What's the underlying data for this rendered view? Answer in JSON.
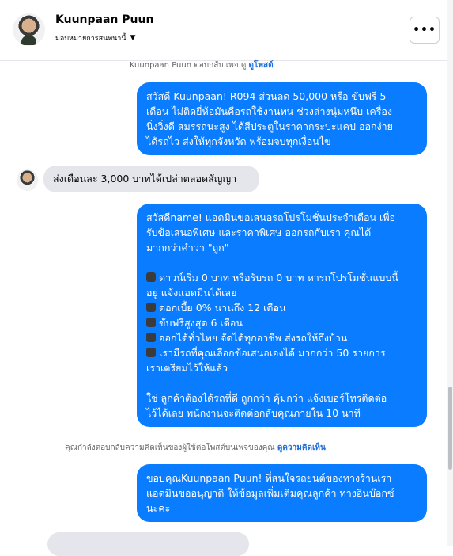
{
  "header": {
    "contact_name": "Kuunpaan Puun",
    "assign_label": "มอบหมายการสนทนานี้",
    "more_label": "•••"
  },
  "messages": {
    "top_note": {
      "text": "Kuunpaan Puun ตอบกลับ เพจ ดู",
      "link": "ดูโพสต์"
    },
    "out1": {
      "lines": [
        "สวัสดี Kuunpaan! R094 ส่วนลด 50,000 หรือ ขับฟรี 5",
        "เดือน ไม่ติดยี่ห้อมันคือรถใช้งานทน ช่วงล่างนุ่มหนึบ เครื่อง",
        "นิ่งวิ่งดี สมรรถนะสูง ได้สีประตูในราคากระบะแคป ออกง่าย",
        "ได้รถไว ส่งให้ทุกจังหวัด พร้อมจบทุกเงื่อนไข"
      ]
    },
    "in1": {
      "text": "ส่งเดือนละ 3,000 บาทได้เปล่าตลอดสัญญา"
    },
    "out2": {
      "intro": [
        "สวัสดีname! แอดมินขอเสนอรถโปรโมชั่นประจำเดือน เพื่อ",
        "รับข้อเสนอพิเศษ และราคาพิเศษ ออกรถกับเรา คุณได้",
        "มากกว่าคำว่า \"ถูก\""
      ],
      "bullets": [
        "ดาวน์เริ่ม 0 บาท หรือรับรถ 0 บาท หารถโปรโมชั่นแบบนี้",
        "อยู่ แจ้งแอดมินได้เลย",
        "ดอกเบี้ย 0% นานถึง 12 เดือน",
        "ขับฟรีสูงสุด 6 เดือน",
        "ออกได้ทั่วไทย จัดได้ทุกอาชีพ ส่งรถให้ถึงบ้าน",
        "เรามีรถที่คุณเลือกข้อเสนอเองได้ มากกว่า 50 รายการ",
        "เราเตรียมไว้ให้แล้ว"
      ],
      "closing": [
        "ใช่ ลูกค้าต้องได้รถที่ดี ถูกกว่า คุ้มกว่า แจ้งเบอร์โทรติดต่อ",
        "ไว้ได้เลย พนักงานจะติดต่อกลับคุณภายใน 10 นาที"
      ]
    },
    "comment_note": {
      "text": "คุณกำลังตอบกลับความคิดเห็นของผู้ใช้ต่อโพสต์บนเพจของคุณ",
      "link": "ดูความคิดเห็น"
    },
    "out3": {
      "lines": [
        "ขอบคุณKuunpaan Puun! ที่สนใจรถยนต์ของทางร้านเรา",
        "แอดมินขออนุญาติ ให้ข้อมูลเพิ่มเติมคุณลูกค้า ทางอินบ๊อกซ์",
        "นะคะ"
      ]
    }
  },
  "colors": {
    "outgoing_bubble": "#0a7cff",
    "incoming_bubble": "#e4e6eb",
    "link": "#216fdb"
  }
}
